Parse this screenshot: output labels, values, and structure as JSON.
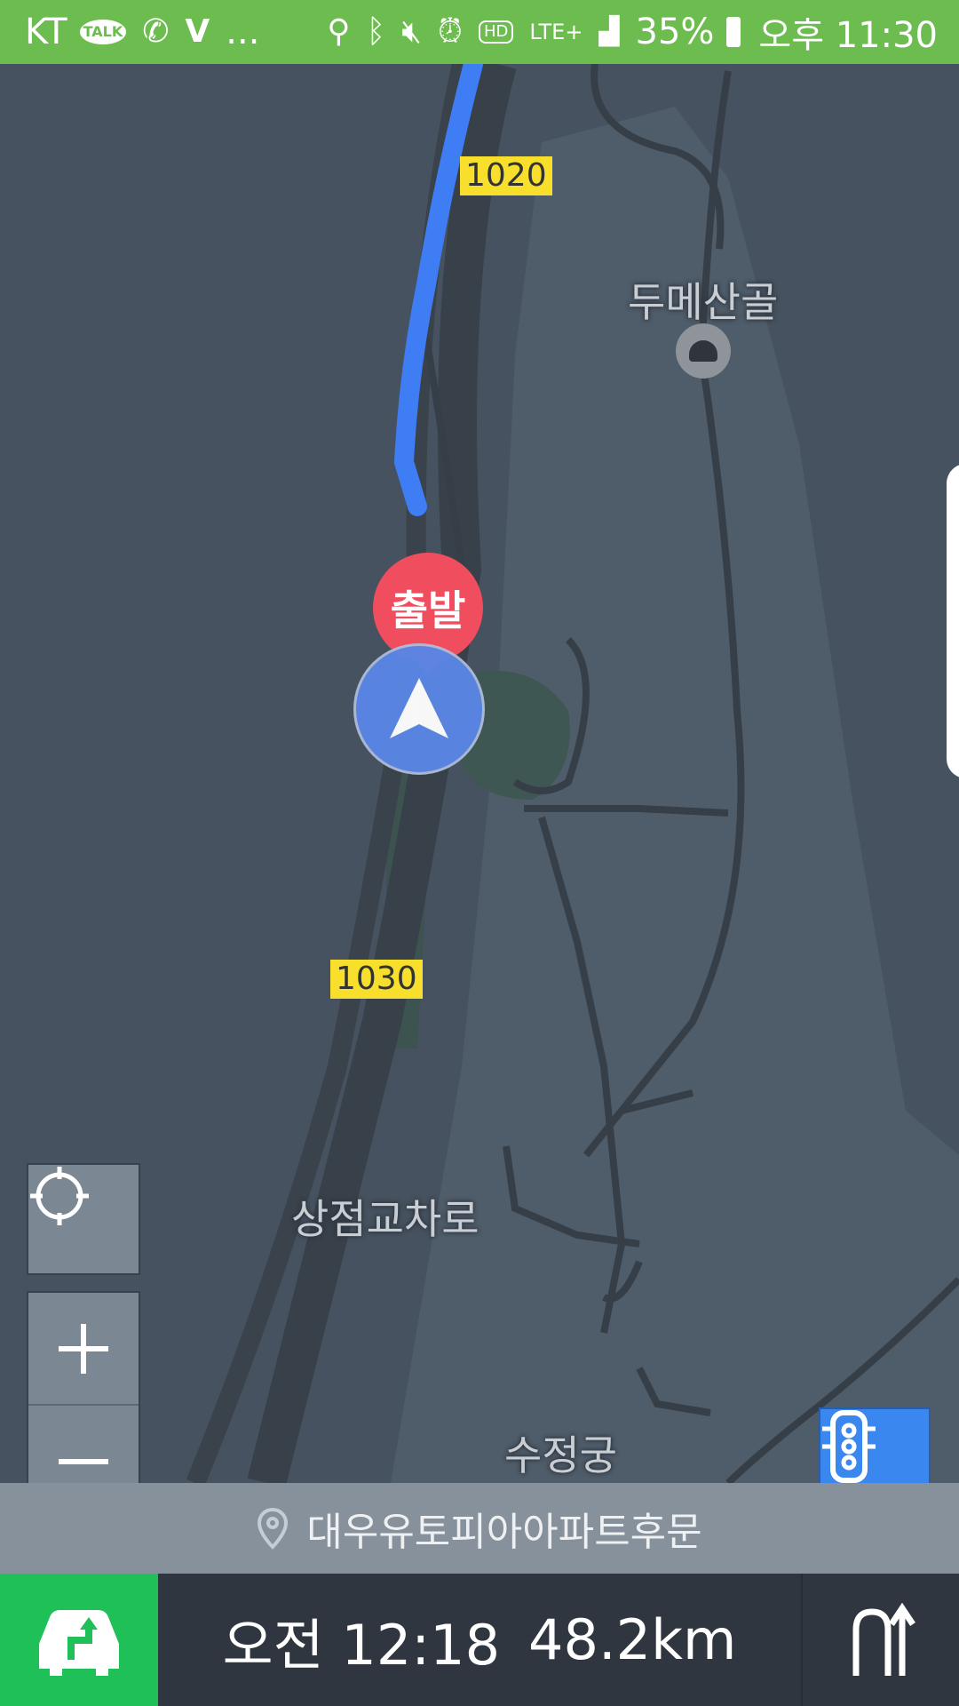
{
  "status_bar": {
    "carrier": "KT",
    "talk_badge": "TALK",
    "overflow": "...",
    "hd_badge": "HD",
    "network": "LTE+",
    "battery": "35%",
    "clock": "오후 11:30"
  },
  "map": {
    "road_badges": [
      "1020",
      "1030"
    ],
    "places": {
      "dume": "두메산골",
      "sangjeom": "상점교차로",
      "sujeong": "수정궁"
    },
    "start_label": "출발"
  },
  "destination": {
    "name": "대우유토피아아파트후문"
  },
  "eta": {
    "time": "오전 12:18",
    "distance": "48.2km"
  },
  "colors": {
    "status_bar": "#6dbc4f",
    "route": "#3f7df5",
    "start_pin": "#f04e5e",
    "nav_marker": "#5a86e6",
    "route_button": "#1fc057",
    "traffic_button": "#3a87f0"
  },
  "icons": [
    "talk-icon",
    "phone-bluetooth-icon",
    "v-app-icon",
    "location-icon",
    "bluetooth-icon",
    "mute-icon",
    "alarm-icon",
    "signal-icon",
    "battery-icon",
    "locate-icon",
    "zoom-in-icon",
    "zoom-out-icon",
    "traffic-light-icon",
    "destination-pin-icon",
    "route-car-icon",
    "u-turn-icon"
  ]
}
